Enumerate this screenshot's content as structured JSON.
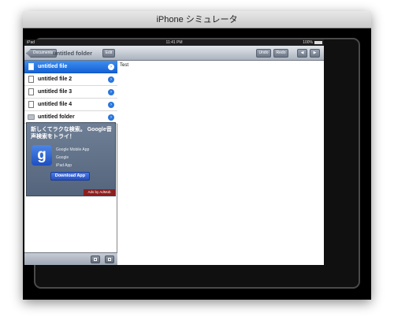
{
  "window": {
    "title": "iPhone シミュレータ"
  },
  "status_bar": {
    "carrier": "iPad",
    "time": "11:41 PM",
    "battery": "100%"
  },
  "sidebar": {
    "back_label": "Documents",
    "title": "untitled folder",
    "edit_label": "Edit",
    "items": [
      {
        "label": "untitled file",
        "kind": "file",
        "selected": true
      },
      {
        "label": "untitled file 2",
        "kind": "file",
        "selected": false
      },
      {
        "label": "untitled file 3",
        "kind": "file",
        "selected": false
      },
      {
        "label": "untitled file 4",
        "kind": "file",
        "selected": false
      },
      {
        "label": "untitled folder",
        "kind": "folder",
        "selected": false
      }
    ],
    "ad": {
      "headline": "新しくてラクな検索。 Google音声検索をトライ！",
      "icon_letter": "g",
      "app_name": "Google Mobile App",
      "publisher": "Google",
      "category": "iPad App",
      "button": "Download App",
      "badge": "Ads by AdMob"
    }
  },
  "editor": {
    "undo_label": "Undo",
    "redo_label": "Redo",
    "prev_label": "◀",
    "next_label": "▶",
    "content": "Test"
  }
}
